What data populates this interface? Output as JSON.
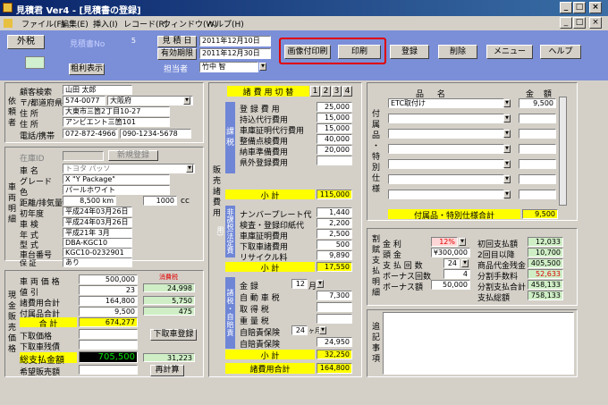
{
  "window": {
    "title": "見積君 Ver4 - [見積書の登録]"
  },
  "menu": [
    "ファイル(F)",
    "編集(E)",
    "挿入(I)",
    "レコード(R)",
    "ウィンドウ(W)",
    "ヘルプ(H)"
  ],
  "toolbar": {
    "tax_button": "外税",
    "estimate_no_label": "見積書No.",
    "estimate_no_value": "5",
    "gross_profit_button": "粗利表示",
    "estimate_date_label": "見 積 日",
    "estimate_date_value": "2011年12月10日",
    "valid_until_label": "有効期限",
    "valid_until_value": "2011年12月30日",
    "staff_label": "担当者",
    "staff_value": "竹中 智",
    "print_with_image": "画像付印刷",
    "print": "印刷",
    "register": "登録",
    "delete": "削除",
    "menu": "メニュー",
    "help": "ヘルプ"
  },
  "client": {
    "section": "依頼者",
    "labels": [
      "顧客検索",
      "〒/都道府県",
      "住 所",
      "住 所",
      "電話/携帯"
    ],
    "search": "山田 太郎",
    "zip": "574-0077",
    "pref": "大阪府",
    "addr1": "大東市三箇2丁目10-27",
    "addr2": "アンビエント三箇101",
    "tel": "072-872-4966",
    "mobile": "090-1234-5678"
  },
  "vehicle": {
    "section": "車両明細",
    "stock_label": "在庫ID",
    "new_register": "新規登録",
    "labels": [
      "車 名",
      "グレード",
      "色",
      "距離/排気量",
      "初年度",
      "車 検",
      "年 式",
      "型 式",
      "車台番号",
      "保 証"
    ],
    "name": "トヨタ パッソ",
    "grade": "X \"Y Package\"",
    "color": "パールホワイト",
    "mileage": "8,500 km",
    "cc": "1000",
    "cc_unit": "cc",
    "first_reg": "平成24年03月26日",
    "inspection": "平成24年03月26日",
    "model_year": "平成21年 3月",
    "model_code": "DBA-KGC10",
    "chassis": "KGC10-0232901",
    "warranty": "あり"
  },
  "cash": {
    "section": "現金販売価格",
    "labels": [
      "車 両 価 格",
      "値 引",
      "諸費用合計",
      "付属品合計",
      "合 計",
      "下取価格",
      "下取車残債",
      "総支払金額",
      "希望販売額"
    ],
    "car_price": "500,000",
    "discount": "23",
    "fees": "164,800",
    "accessories": "9,500",
    "total": "674,277",
    "total_pay": "705,500",
    "tax_label": "消費税",
    "tax_values": [
      "24,998",
      "5,750",
      "475"
    ],
    "tax_total": "31,223",
    "tradein_button": "下取車登録",
    "recalc_button": "再計算"
  },
  "fees": {
    "header": "諸 費 用 切 替",
    "tabs": [
      "1",
      "2",
      "3",
      "4"
    ],
    "section_label": "販売諸費用",
    "taxed_label": "課税",
    "taxed_items": [
      "登 録 費 用",
      "持込代行費用",
      "車庫証明代行費用",
      "整備点検費用",
      "納車準備費用",
      "県外登録費用"
    ],
    "taxed_values": [
      "25,000",
      "15,000",
      "15,000",
      "40,000",
      "20,000",
      ""
    ],
    "subtotal_label": "小 計",
    "taxed_subtotal": "115,000",
    "nontax_label": "非課税",
    "nontax_sub": "(法定費用)",
    "nontax_items": [
      "ナンバープレート代",
      "検査・登録印紙代",
      "車庫証明費用",
      "下取車諸費用",
      "リサイクル料"
    ],
    "nontax_values": [
      "1,440",
      "2,200",
      "2,500",
      "500",
      "9,890"
    ],
    "nontax_subtotal": "17,550",
    "misc_label": "諸税・自賠責",
    "misc_items": [
      "金 録",
      "自 動 車 税",
      "取 得 税",
      "重 量 税",
      "自賠責保険",
      "自賠責保険"
    ],
    "month_reg": "12",
    "month_unit": "月",
    "misc_values": [
      "",
      "7,300",
      "",
      "",
      "",
      ""
    ],
    "ins_months": "24",
    "ins_unit": "ヶ月",
    "ins_value": "24,950",
    "misc_subtotal": "32,250",
    "grand_label": "諸費用合計",
    "grand_total": "164,800"
  },
  "accessories": {
    "section": "付属品・特別仕様",
    "col_name": "品 名",
    "col_amount": "金 額",
    "rows": [
      {
        "name": "ETC取付け",
        "amount": "9,500"
      },
      {
        "name": "",
        "amount": ""
      },
      {
        "name": "",
        "amount": ""
      },
      {
        "name": "",
        "amount": ""
      },
      {
        "name": "",
        "amount": ""
      },
      {
        "name": "",
        "amount": ""
      },
      {
        "name": "",
        "amount": ""
      }
    ],
    "total_label": "付属品・特別仕様合計",
    "total": "9,500"
  },
  "loan": {
    "section": "割賦支払明細",
    "labels": [
      "金 利",
      "頭 金",
      "支 払 回 数",
      "ボーナス回数",
      "ボーナス額"
    ],
    "rate": "12%",
    "down": "¥300,000",
    "count": "24",
    "bonus_count": "4",
    "bonus_amount": "50,000",
    "right_labels": [
      "初回支払額",
      "2回目以降",
      "商品代金残金",
      "分割手数料",
      "分割支払合計",
      "支払総額"
    ],
    "right_values": [
      "12,033",
      "10,700",
      "405,500",
      "52,633",
      "458,133",
      "758,133"
    ]
  },
  "notes": {
    "section": "追記事項"
  }
}
